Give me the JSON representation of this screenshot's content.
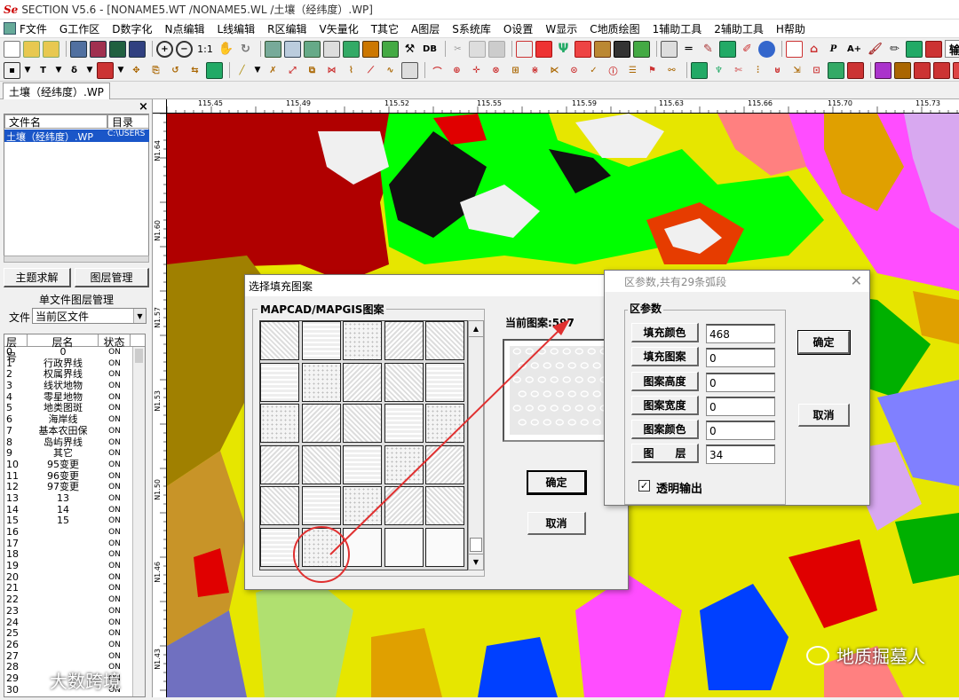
{
  "app": {
    "title_logo": "Se",
    "title": "SECTION V5.6 - [NONAME5.WT /NONAME5.WL /土壤（经纬度）.WP]"
  },
  "menu": [
    "F文件",
    "G工作区",
    "D数字化",
    "N点编辑",
    "L线编辑",
    "R区编辑",
    "V矢量化",
    "T其它",
    "A图层",
    "S系统库",
    "O设置",
    "W显示",
    "C地质绘图",
    "1辅助工具",
    "2辅助工具",
    "H帮助"
  ],
  "toolbar": {
    "zoom_ratio": "1:1",
    "db_label": "DB",
    "p_label": "P",
    "aplus_label": "A+",
    "search_text": "输入搜索内容,"
  },
  "toolbar2": {
    "t_label": "T",
    "delta_label": "δ"
  },
  "tabs": {
    "active": "土壤（经纬度）.WP"
  },
  "left_panel": {
    "close": "×",
    "file_header": "文件名",
    "dir_header": "目录",
    "file_row_name": "土壤（经纬度）.WP",
    "file_row_dir": "C:\\USERS",
    "btn_theme": "主题求解",
    "btn_layer_mgr": "图层管理",
    "group_title": "单文件图层管理",
    "file_label": "文件",
    "file_select": "当前区文件",
    "col_num": "层号",
    "col_name": "层名",
    "col_state": "状态",
    "layers": [
      {
        "n": "0",
        "name": "0",
        "s": "ON"
      },
      {
        "n": "1",
        "name": "行政界线",
        "s": "ON"
      },
      {
        "n": "2",
        "name": "权属界线",
        "s": "ON"
      },
      {
        "n": "3",
        "name": "线状地物",
        "s": "ON"
      },
      {
        "n": "4",
        "name": "零星地物",
        "s": "ON"
      },
      {
        "n": "5",
        "name": "地类图斑",
        "s": "ON"
      },
      {
        "n": "6",
        "name": "海岸线",
        "s": "ON"
      },
      {
        "n": "7",
        "name": "基本农田保",
        "s": "ON"
      },
      {
        "n": "8",
        "name": "岛屿界线",
        "s": "ON"
      },
      {
        "n": "9",
        "name": "其它",
        "s": "ON"
      },
      {
        "n": "10",
        "name": "95变更",
        "s": "ON"
      },
      {
        "n": "11",
        "name": "96变更",
        "s": "ON"
      },
      {
        "n": "12",
        "name": "97变更",
        "s": "ON"
      },
      {
        "n": "13",
        "name": "13",
        "s": "ON"
      },
      {
        "n": "14",
        "name": "14",
        "s": "ON"
      },
      {
        "n": "15",
        "name": "15",
        "s": "ON"
      },
      {
        "n": "16",
        "name": "",
        "s": "ON"
      },
      {
        "n": "17",
        "name": "",
        "s": "ON"
      },
      {
        "n": "18",
        "name": "",
        "s": "ON"
      },
      {
        "n": "19",
        "name": "",
        "s": "ON"
      },
      {
        "n": "20",
        "name": "",
        "s": "ON"
      },
      {
        "n": "21",
        "name": "",
        "s": "ON"
      },
      {
        "n": "22",
        "name": "",
        "s": "ON"
      },
      {
        "n": "23",
        "name": "",
        "s": "ON"
      },
      {
        "n": "24",
        "name": "",
        "s": "ON"
      },
      {
        "n": "25",
        "name": "",
        "s": "ON"
      },
      {
        "n": "26",
        "name": "",
        "s": "ON"
      },
      {
        "n": "27",
        "name": "",
        "s": "ON"
      },
      {
        "n": "28",
        "name": "",
        "s": "ON"
      },
      {
        "n": "29",
        "name": "",
        "s": "ON"
      },
      {
        "n": "30",
        "name": "",
        "s": "ON"
      }
    ]
  },
  "ruler": {
    "top": [
      "115.45",
      "115.49",
      "115.52",
      "115.55",
      "115.59",
      "115.63",
      "115.66",
      "115.70",
      "115.73"
    ],
    "left": [
      "N1.64",
      "N1.60",
      "N1.57",
      "N1.53",
      "N1.50",
      "N1.46",
      "N1.43"
    ]
  },
  "fill_dialog": {
    "title": "选择填充图案",
    "group_title": "MAPCAD/MAPGIS图案",
    "current_label": "当前图案:597",
    "ok": "确定",
    "cancel": "取消",
    "close": "✕"
  },
  "param_dialog": {
    "title": "区参数,共有29条弧段",
    "group_title": "区参数",
    "fields": [
      {
        "label": "填充颜色",
        "value": "468"
      },
      {
        "label": "填充图案",
        "value": "0"
      },
      {
        "label": "图案高度",
        "value": "0"
      },
      {
        "label": "图案宽度",
        "value": "0"
      },
      {
        "label": "图案颜色",
        "value": "0"
      },
      {
        "label": "图　　层",
        "value": "34"
      }
    ],
    "transparent_label": "透明输出",
    "ok": "确定",
    "cancel": "取消",
    "close": "✕"
  },
  "watermarks": {
    "right": "地质掘墓人",
    "left": "大数跨境"
  },
  "colors": {
    "map_bg": "#e6e600",
    "annotation": "#e03030",
    "title_logo": "#cc0000"
  }
}
